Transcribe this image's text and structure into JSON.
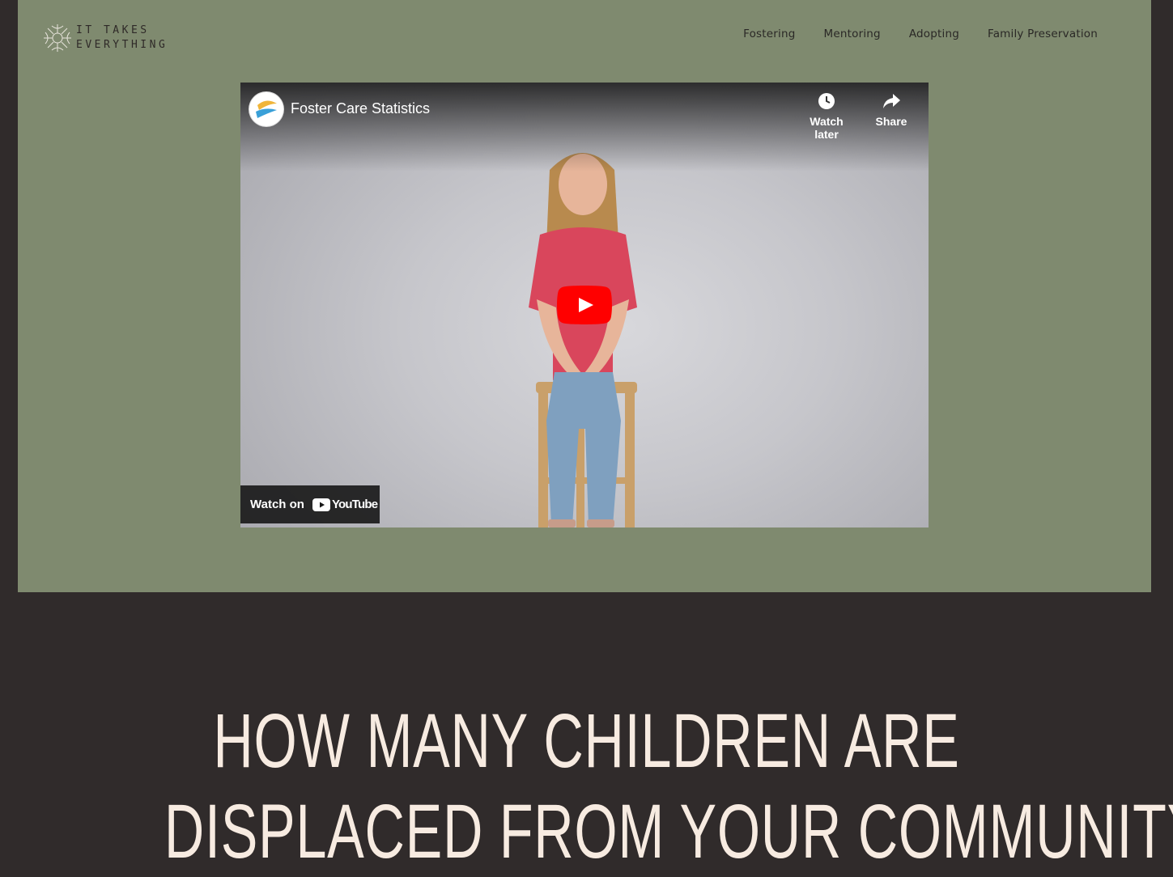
{
  "logo": {
    "line1": "IT TAKES",
    "line2": "EVERYTHING"
  },
  "nav": {
    "items": [
      {
        "label": "Fostering"
      },
      {
        "label": "Mentoring"
      },
      {
        "label": "Adopting"
      },
      {
        "label": "Family Preservation"
      }
    ]
  },
  "video": {
    "title": "Foster Care Statistics",
    "watch_later": "Watch later",
    "share": "Share",
    "watch_on": "Watch on",
    "youtube": "YouTube"
  },
  "headline": {
    "line1": "HOW MANY CHILDREN ARE",
    "line2": "DISPLACED FROM YOUR COMMUNITY"
  },
  "colors": {
    "hero_bg": "#7f8a6f",
    "page_bg": "#302b2b",
    "headline": "#f7ebe1",
    "yt_red": "#ff0000"
  }
}
